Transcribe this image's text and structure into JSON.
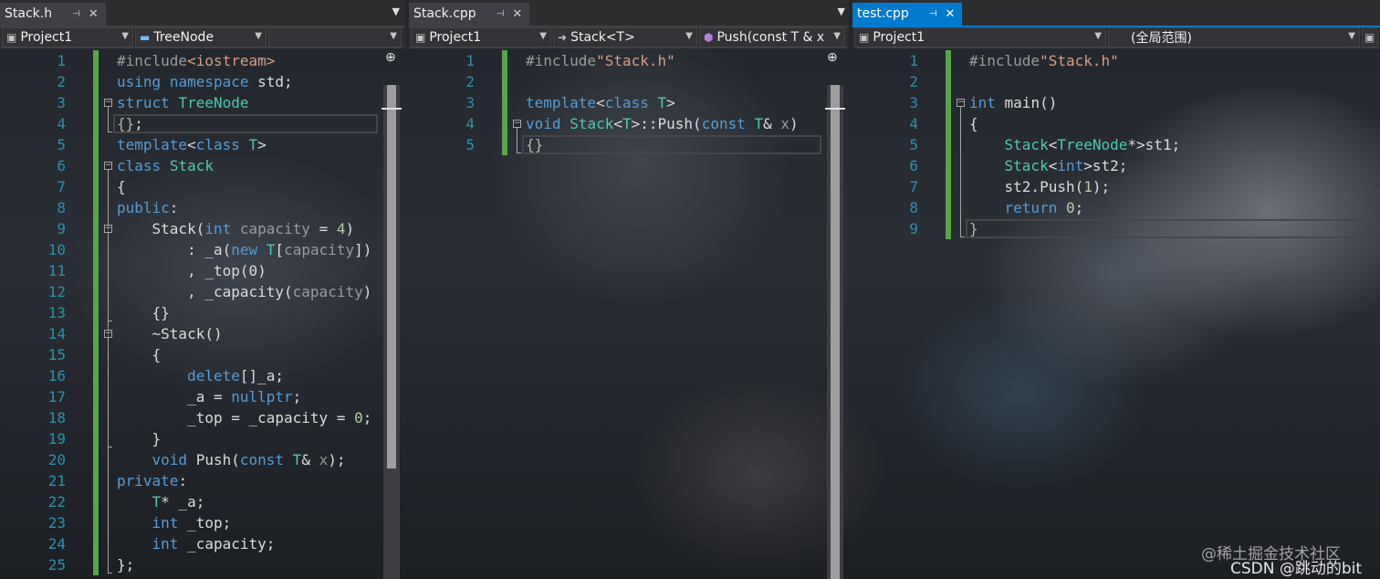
{
  "panes": [
    {
      "tab": {
        "name": "Stack.h",
        "pin": "⊣",
        "close": "✕",
        "active": false
      },
      "nav": {
        "project": "Project1",
        "scope": "TreeNode"
      },
      "lines": [
        {
          "n": "1",
          "t": [
            [
              "pp",
              "#include"
            ],
            [
              "str",
              "<iostream>"
            ]
          ]
        },
        {
          "n": "2",
          "t": [
            [
              "kw",
              "using"
            ],
            [
              "txt",
              " "
            ],
            [
              "kw",
              "namespace"
            ],
            [
              "txt",
              " std;"
            ]
          ]
        },
        {
          "n": "3",
          "t": [
            [
              "kw",
              "struct"
            ],
            [
              "txt",
              " "
            ],
            [
              "ty",
              "TreeNode"
            ]
          ]
        },
        {
          "n": "4",
          "t": [
            [
              "brace",
              "{}"
            ],
            [
              "txt",
              ";"
            ]
          ]
        },
        {
          "n": "5",
          "t": [
            [
              "kw",
              "template"
            ],
            [
              "txt",
              "<"
            ],
            [
              "kw",
              "class"
            ],
            [
              "txt",
              " "
            ],
            [
              "ty",
              "T"
            ],
            [
              "txt",
              ">"
            ]
          ]
        },
        {
          "n": "6",
          "t": [
            [
              "kw",
              "class"
            ],
            [
              "txt",
              " "
            ],
            [
              "ty",
              "Stack"
            ]
          ]
        },
        {
          "n": "7",
          "t": [
            [
              "txt",
              "{"
            ]
          ]
        },
        {
          "n": "8",
          "t": [
            [
              "kw",
              "public"
            ],
            [
              "txt",
              ":"
            ]
          ]
        },
        {
          "n": "9",
          "t": [
            [
              "txt",
              "    Stack("
            ],
            [
              "kw",
              "int"
            ],
            [
              "txt",
              " "
            ],
            [
              "pm",
              "capacity"
            ],
            [
              "txt",
              " = "
            ],
            [
              "num",
              "4"
            ],
            [
              "txt",
              ")"
            ]
          ]
        },
        {
          "n": "10",
          "t": [
            [
              "txt",
              "        : _a("
            ],
            [
              "kw",
              "new"
            ],
            [
              "txt",
              " "
            ],
            [
              "ty",
              "T"
            ],
            [
              "txt",
              "["
            ],
            [
              "pm",
              "capacity"
            ],
            [
              "txt",
              "])"
            ]
          ]
        },
        {
          "n": "11",
          "t": [
            [
              "txt",
              "        , _top(0)"
            ]
          ]
        },
        {
          "n": "12",
          "t": [
            [
              "txt",
              "        , _capacity("
            ],
            [
              "pm",
              "capacity"
            ],
            [
              "txt",
              ")"
            ]
          ]
        },
        {
          "n": "13",
          "t": [
            [
              "txt",
              "    {}"
            ]
          ]
        },
        {
          "n": "14",
          "t": [
            [
              "txt",
              "    ~Stack()"
            ]
          ]
        },
        {
          "n": "15",
          "t": [
            [
              "txt",
              "    {"
            ]
          ]
        },
        {
          "n": "16",
          "t": [
            [
              "txt",
              "        "
            ],
            [
              "kw",
              "delete"
            ],
            [
              "txt",
              "[]_a;"
            ]
          ]
        },
        {
          "n": "17",
          "t": [
            [
              "txt",
              "        _a = "
            ],
            [
              "kw",
              "nullptr"
            ],
            [
              "txt",
              ";"
            ]
          ]
        },
        {
          "n": "18",
          "t": [
            [
              "txt",
              "        _top = _capacity = "
            ],
            [
              "num",
              "0"
            ],
            [
              "txt",
              ";"
            ]
          ]
        },
        {
          "n": "19",
          "t": [
            [
              "txt",
              "    }"
            ]
          ]
        },
        {
          "n": "20",
          "t": [
            [
              "txt",
              "    "
            ],
            [
              "kw",
              "void"
            ],
            [
              "txt",
              " Push("
            ],
            [
              "kw",
              "const"
            ],
            [
              "txt",
              " "
            ],
            [
              "ty",
              "T"
            ],
            [
              "txt",
              "& "
            ],
            [
              "pm",
              "x"
            ],
            [
              "txt",
              ");"
            ]
          ]
        },
        {
          "n": "21",
          "t": [
            [
              "kw",
              "private"
            ],
            [
              "txt",
              ":"
            ]
          ]
        },
        {
          "n": "22",
          "t": [
            [
              "txt",
              "    "
            ],
            [
              "ty",
              "T"
            ],
            [
              "txt",
              "* _a;"
            ]
          ]
        },
        {
          "n": "23",
          "t": [
            [
              "txt",
              "    "
            ],
            [
              "kw",
              "int"
            ],
            [
              "txt",
              " _top;"
            ]
          ]
        },
        {
          "n": "24",
          "t": [
            [
              "txt",
              "    "
            ],
            [
              "kw",
              "int"
            ],
            [
              "txt",
              " _capacity;"
            ]
          ]
        },
        {
          "n": "25",
          "t": [
            [
              "txt",
              "};"
            ]
          ]
        }
      ]
    },
    {
      "tab": {
        "name": "Stack.cpp",
        "pin": "⊣",
        "close": "✕",
        "active": false
      },
      "nav": {
        "project": "Project1",
        "scope": "Stack<T>",
        "member": "Push(const T & x"
      },
      "lines": [
        {
          "n": "1",
          "t": [
            [
              "pp",
              "#include"
            ],
            [
              "str",
              "\"Stack.h\""
            ]
          ]
        },
        {
          "n": "2",
          "t": []
        },
        {
          "n": "3",
          "t": [
            [
              "kw",
              "template"
            ],
            [
              "txt",
              "<"
            ],
            [
              "kw",
              "class"
            ],
            [
              "txt",
              " "
            ],
            [
              "ty",
              "T"
            ],
            [
              "txt",
              ">"
            ]
          ]
        },
        {
          "n": "4",
          "t": [
            [
              "kw",
              "void"
            ],
            [
              "txt",
              " "
            ],
            [
              "ty",
              "Stack"
            ],
            [
              "txt",
              "<"
            ],
            [
              "ty",
              "T"
            ],
            [
              "txt",
              ">::Push("
            ],
            [
              "kw",
              "const"
            ],
            [
              "txt",
              " "
            ],
            [
              "ty",
              "T"
            ],
            [
              "txt",
              "& "
            ],
            [
              "pm",
              "x"
            ],
            [
              "txt",
              ")"
            ]
          ]
        },
        {
          "n": "5",
          "t": [
            [
              "brace",
              "{}"
            ]
          ]
        }
      ]
    },
    {
      "tab": {
        "name": "test.cpp",
        "pin": "⊣",
        "close": "✕",
        "active": true
      },
      "nav": {
        "project": "Project1",
        "scope": "(全局范围)"
      },
      "lines": [
        {
          "n": "1",
          "t": [
            [
              "pp",
              "#include"
            ],
            [
              "str",
              "\"Stack.h\""
            ]
          ]
        },
        {
          "n": "2",
          "t": []
        },
        {
          "n": "3",
          "t": [
            [
              "kw",
              "int"
            ],
            [
              "txt",
              " main()"
            ]
          ]
        },
        {
          "n": "4",
          "t": [
            [
              "txt",
              "{"
            ]
          ]
        },
        {
          "n": "5",
          "t": [
            [
              "txt",
              "    "
            ],
            [
              "ty",
              "Stack"
            ],
            [
              "txt",
              "<"
            ],
            [
              "ty",
              "TreeNode"
            ],
            [
              "txt",
              "*>st1;"
            ]
          ]
        },
        {
          "n": "6",
          "t": [
            [
              "txt",
              "    "
            ],
            [
              "ty",
              "Stack"
            ],
            [
              "txt",
              "<"
            ],
            [
              "kw",
              "int"
            ],
            [
              "txt",
              ">st2;"
            ]
          ]
        },
        {
          "n": "7",
          "t": [
            [
              "txt",
              "    st2.Push("
            ],
            [
              "num",
              "1"
            ],
            [
              "txt",
              ");"
            ]
          ]
        },
        {
          "n": "8",
          "t": [
            [
              "txt",
              "    "
            ],
            [
              "kw",
              "return"
            ],
            [
              "txt",
              " "
            ],
            [
              "num",
              "0"
            ],
            [
              "txt",
              ";"
            ]
          ]
        },
        {
          "n": "9",
          "t": [
            [
              "brace",
              "}"
            ]
          ]
        }
      ]
    }
  ],
  "watermark": {
    "line1": "@稀土掘金技术社区",
    "line2": "CSDN @跳动的bit"
  }
}
